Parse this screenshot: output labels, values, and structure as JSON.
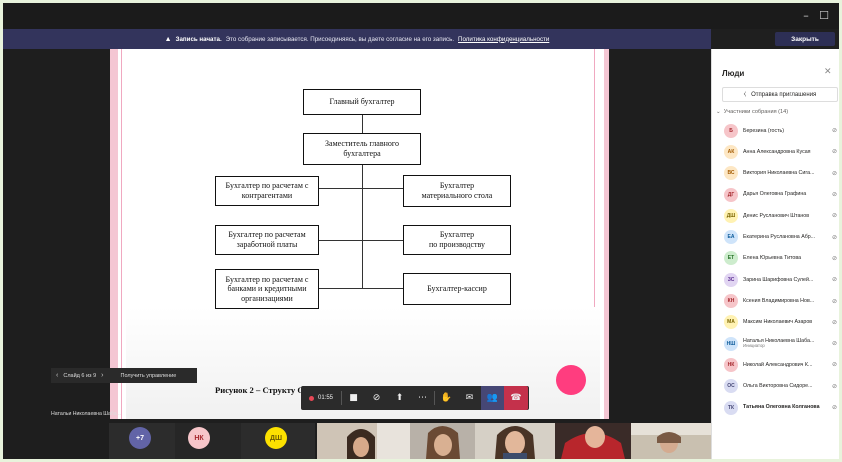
{
  "window": {
    "minimize": "–",
    "maximize": "☐"
  },
  "banner": {
    "lead": "Запись начата.",
    "text": "Это собрание записывается. Присоединяясь, вы даете согласие на его запись.",
    "link": "Политика конфиденциальности",
    "close_label": "Закрыть"
  },
  "slide": {
    "chief": "Главный бухгалтер",
    "deputy_1": "Заместитель главного",
    "deputy_2": "бухгалтера",
    "left_1a": "Бухгалтер по расчетам с",
    "left_1b": "контрагентами",
    "left_2a": "Бухгалтер по расчетам",
    "left_2b": "заработной платы",
    "left_3a": "Бухгалтер по расчетам с",
    "left_3b": "банками и кредитными",
    "left_3c": "организациями",
    "right_1a": "Бухгалтер",
    "right_1b": "материального стола",
    "right_2a": "Бухгалтер",
    "right_2b": "по производству",
    "right_3": "Бухгалтер-кассир",
    "caption": "Рисунок 2 – Структу            ООО «Д                  КУ»"
  },
  "slide_nav": {
    "prev": "‹",
    "counter": "Слайд 6 из 9",
    "next": "›",
    "take_control": "Получить управление"
  },
  "presenter": "Натальи Николаевна Шаба...",
  "controls": {
    "timer": "01:55",
    "camera": "■",
    "mic": "⊘",
    "share": "⬆",
    "more": "⋯",
    "hand": "✋",
    "chat": "✉",
    "people": "👥",
    "hangup": "☎"
  },
  "gallery": [
    {
      "initials": "+7",
      "bg": "#6264a7",
      "fg": "#ffffff"
    },
    {
      "initials": "НК",
      "bg": "#f6c5c9",
      "fg": "#a4262c"
    },
    {
      "initials": "ДШ",
      "bg": "#fce100",
      "fg": "#6b5a00"
    }
  ],
  "people": {
    "title": "Люди",
    "invite": "Отправка приглашения",
    "members_header": "Участники собрания (14)",
    "members": [
      {
        "initials": "Б",
        "name": "Березина (гость)",
        "role": "",
        "bg": "#f6c5c9",
        "fg": "#a4262c"
      },
      {
        "initials": "АК",
        "name": "Анна Александровна Кусая",
        "role": "",
        "bg": "#fde7c4",
        "fg": "#a35a00"
      },
      {
        "initials": "ВС",
        "name": "Виктория Николаевна Сига...",
        "role": "",
        "bg": "#fde7c4",
        "fg": "#a35a00"
      },
      {
        "initials": "ДГ",
        "name": "Дарья Олеговна Графина",
        "role": "",
        "bg": "#f6c5c9",
        "fg": "#a4262c"
      },
      {
        "initials": "ДШ",
        "name": "Денис Русланович Штанов",
        "role": "",
        "bg": "#fff2b3",
        "fg": "#7a6400"
      },
      {
        "initials": "ЕА",
        "name": "Екатерина Руслановна Абр...",
        "role": "",
        "bg": "#cfe4fa",
        "fg": "#0b5a99"
      },
      {
        "initials": "ЕТ",
        "name": "Елена Юрьевна Титова",
        "role": "",
        "bg": "#cdeccd",
        "fg": "#257025"
      },
      {
        "initials": "ЗС",
        "name": "Зарина Шарифовна Сулей...",
        "role": "",
        "bg": "#e1d5f2",
        "fg": "#5c2e91"
      },
      {
        "initials": "КН",
        "name": "Ксения Владимировна Нов...",
        "role": "",
        "bg": "#f6c5c9",
        "fg": "#a4262c"
      },
      {
        "initials": "МА",
        "name": "Максим Николаевич Азаров",
        "role": "",
        "bg": "#fff2b3",
        "fg": "#7a6400"
      },
      {
        "initials": "НШ",
        "name": "Наталья Николаевна Шаба...",
        "role": "Инициатор",
        "bg": "#cfe4fa",
        "fg": "#0b5a99"
      },
      {
        "initials": "НК",
        "name": "Николай Александрович К...",
        "role": "",
        "bg": "#f6c5c9",
        "fg": "#a4262c"
      },
      {
        "initials": "ОС",
        "name": "Ольга Викторовна Сидоре...",
        "role": "",
        "bg": "#d9dcf2",
        "fg": "#464775"
      },
      {
        "initials": "ТК",
        "name": "Татьяна Олеговна Колганова",
        "role": "",
        "bg": "#d9dcf2",
        "fg": "#464775",
        "bold": true
      }
    ]
  }
}
